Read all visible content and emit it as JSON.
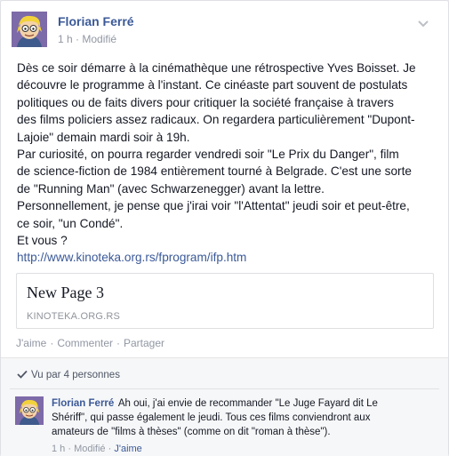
{
  "post": {
    "author": "Florian Ferré",
    "time": "1 h",
    "separator": " · ",
    "edited": "Modifié",
    "text": "Dès ce soir démarre à la cinémathèque une rétrospective Yves Boisset. Je\ndécouvre le programme à l'instant. Ce cinéaste part souvent de postulats\npolitiques ou de faits divers pour critiquer la société française à travers\ndes films policiers assez radicaux. On regardera particulièrement \"Dupont-\nLajoie\" demain mardi soir à 19h.\nPar curiosité, on pourra regarder vendredi soir \"Le Prix du Danger\", film\nde science-fiction de 1984 entièrement tourné à Belgrade. C'est une sorte\nde \"Running Man\" (avec Schwarzenegger) avant la lettre.\nPersonnellement, je pense que j'irai voir \"l'Attentat\" jeudi soir et peut-être,\nce soir, \"un Condé\".\nEt vous ?",
    "link": "http://www.kinoteka.org.rs/fprogram/ifp.htm"
  },
  "preview": {
    "title": "New Page 3",
    "domain": "KINOTEKA.ORG.RS"
  },
  "actions": {
    "like": "J'aime",
    "comment": "Commenter",
    "share": "Partager",
    "dot": "·"
  },
  "feedback": {
    "seen_by": "Vu par 4 personnes"
  },
  "comment": {
    "author": "Florian Ferré",
    "text": "Ah oui, j'ai envie de recommander \"Le Juge Fayard dit Le Shériff\", qui passe également le jeudi. Tous ces films conviendront aux amateurs de \"films à thèses\" (comme on dit \"roman à thèse\").",
    "time": "1 h",
    "edited": "Modifié",
    "like": "J'aime",
    "dot": "·"
  },
  "icons": {
    "avatar": "cartoon-avatar-icon",
    "menu": "chevron-down-icon",
    "seen": "checkmark-icon"
  },
  "colors": {
    "link": "#3b5998",
    "meta": "#9197a3",
    "avatar_bg": "#7d6aa8"
  }
}
